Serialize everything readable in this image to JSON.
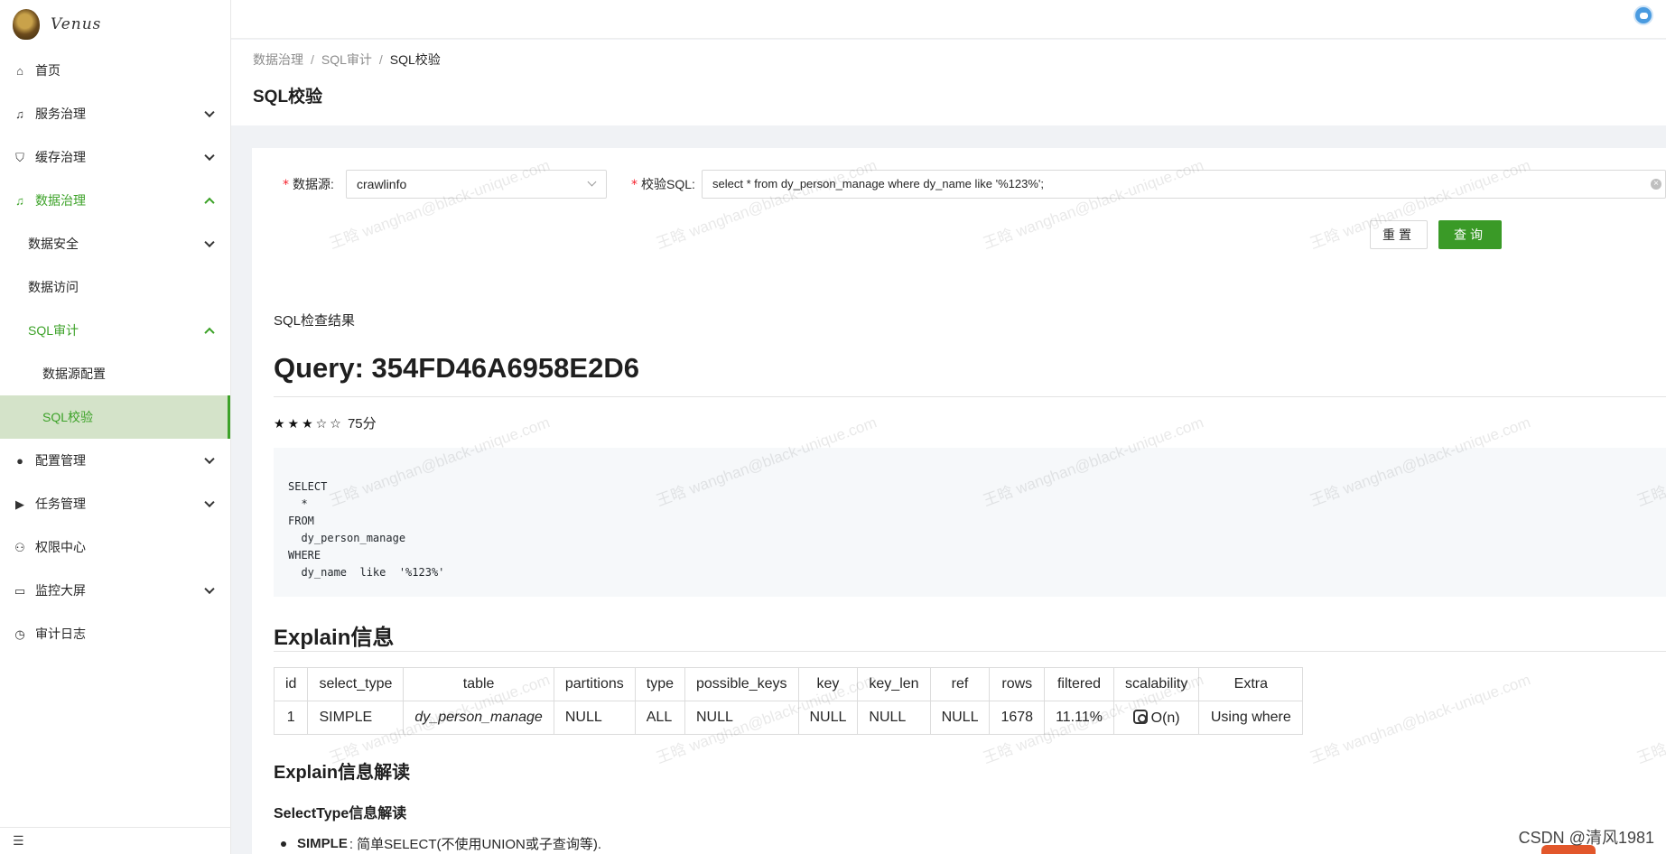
{
  "app": {
    "logo_text": "Venus"
  },
  "sidebar": {
    "items": [
      {
        "label": "首页",
        "icon": "home-icon"
      },
      {
        "label": "服务治理",
        "icon": "bell-icon"
      },
      {
        "label": "缓存治理",
        "icon": "shield-icon"
      },
      {
        "label": "数据治理",
        "icon": "bell-icon"
      },
      {
        "label": "数据安全"
      },
      {
        "label": "数据访问"
      },
      {
        "label": "SQL审计"
      },
      {
        "label": "数据源配置"
      },
      {
        "label": "SQL校验"
      },
      {
        "label": "配置管理",
        "icon": "apple-icon"
      },
      {
        "label": "任务管理",
        "icon": "play-icon"
      },
      {
        "label": "权限中心",
        "icon": "user-icon"
      },
      {
        "label": "监控大屏",
        "icon": "laptop-icon"
      },
      {
        "label": "审计日志",
        "icon": "history-icon"
      }
    ]
  },
  "breadcrumb": [
    "数据治理",
    "SQL审计",
    "SQL校验"
  ],
  "page_title": "SQL校验",
  "form": {
    "datasource_label": "数据源:",
    "datasource_value": "crawlinfo",
    "sql_label": "校验SQL:",
    "sql_value": "select * from dy_person_manage where dy_name like '%123%';",
    "reset_label": "重置",
    "query_label": "查询"
  },
  "result": {
    "title": "SQL检查结果",
    "query_heading": "Query: 354FD46A6958E2D6",
    "stars": "★★★☆☆",
    "score": "75分",
    "sql_formatted": "SELECT\n  *\nFROM\n  dy_person_manage\nWHERE\n  dy_name  like  '%123%'"
  },
  "explain": {
    "heading": "Explain信息",
    "columns": [
      "id",
      "select_type",
      "table",
      "partitions",
      "type",
      "possible_keys",
      "key",
      "key_len",
      "ref",
      "rows",
      "filtered",
      "scalability",
      "Extra"
    ],
    "rows": [
      [
        "1",
        "SIMPLE",
        "dy_person_manage",
        "NULL",
        "ALL",
        "NULL",
        "NULL",
        "NULL",
        "NULL",
        "1678",
        "11.11%",
        "O(n)",
        "Using where"
      ]
    ]
  },
  "interpretation": {
    "heading": "Explain信息解读",
    "select_type_heading": "SelectType信息解读",
    "bullet_term": "SIMPLE",
    "bullet_text": ": 简单SELECT(不使用UNION或子查询等)."
  },
  "watermark": "王晗 wanghan@black-unique.com",
  "footer": {
    "csdn": "CSDN @清风1981"
  },
  "colors": {
    "accent": "#3a9a27",
    "selected_bg": "#d4e3c9"
  }
}
